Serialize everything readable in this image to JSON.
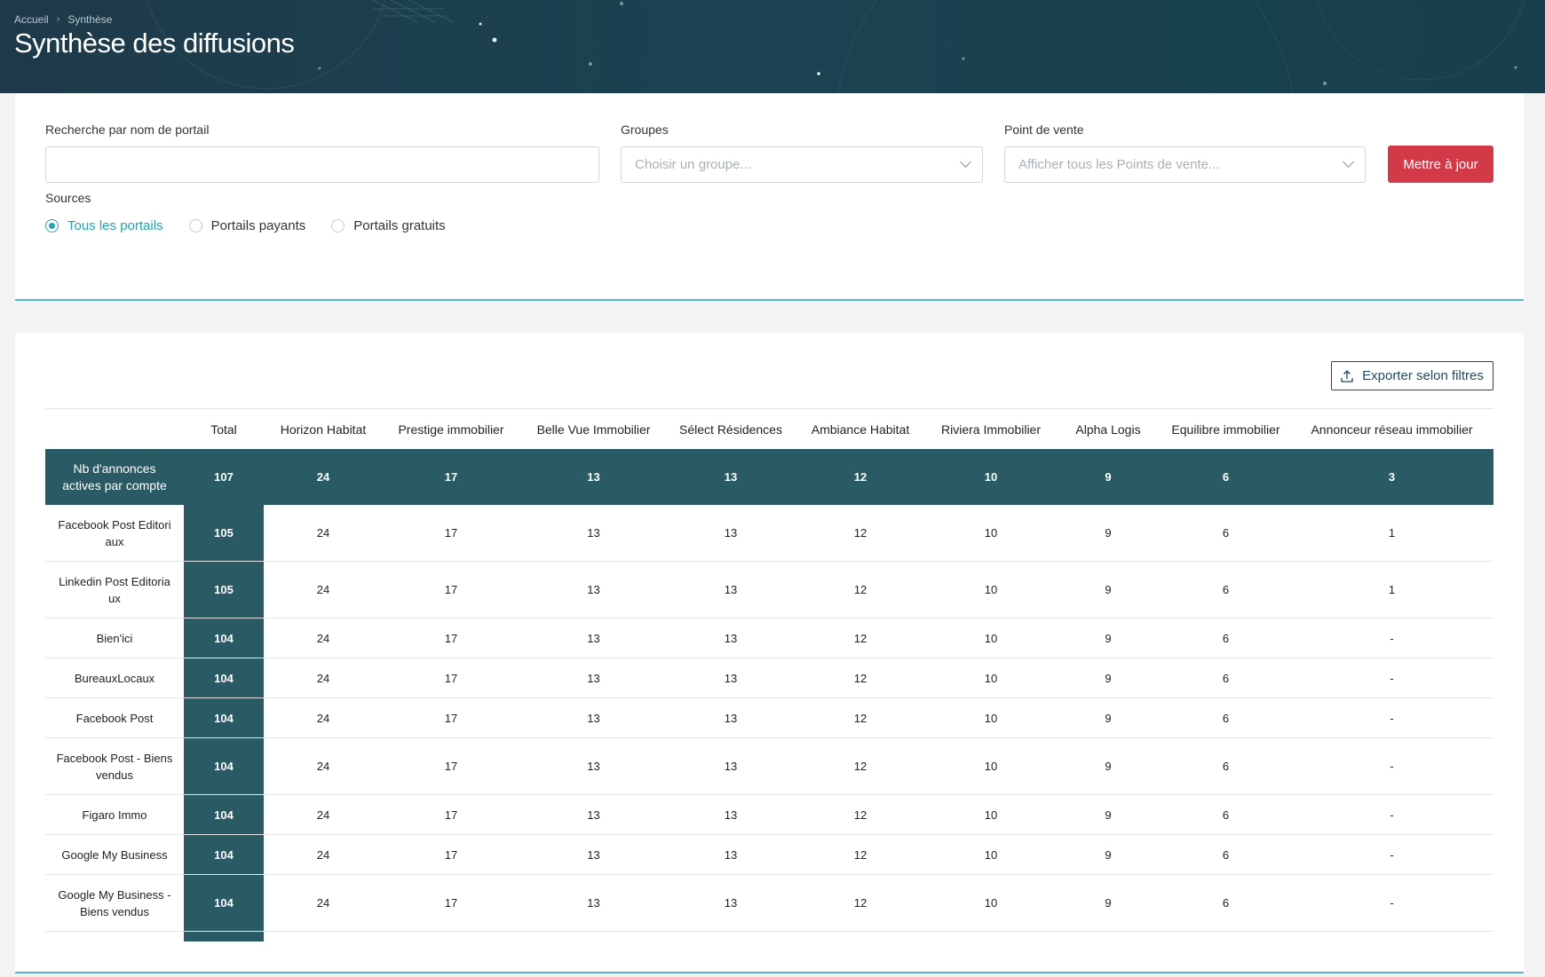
{
  "breadcrumb": {
    "home": "Accueil",
    "current": "Synthèse"
  },
  "page_title": "Synthèse des diffusions",
  "filters": {
    "search_label": "Recherche par nom de portail",
    "search_value": "",
    "groups_label": "Groupes",
    "groups_placeholder": "Choisir un groupe...",
    "pos_label": "Point de vente",
    "pos_placeholder": "Afficher tous les Points de vente...",
    "update_button": "Mettre à jour",
    "sources_label": "Sources",
    "sources": [
      {
        "label": "Tous les portails",
        "checked": true
      },
      {
        "label": "Portails payants",
        "checked": false
      },
      {
        "label": "Portails gratuits",
        "checked": false
      }
    ]
  },
  "export_button": "Exporter selon filtres",
  "table": {
    "headers": [
      "",
      "Total",
      "Horizon Habitat",
      "Prestige immobilier",
      "Belle Vue Immobilier",
      "Sélect Résidences",
      "Ambiance Habitat",
      "Riviera Immobilier",
      "Alpha Logis",
      "Equilibre immobilier",
      "Annonceur réseau immobilier"
    ],
    "summary": {
      "label": "Nb d'annonces actives par compte",
      "values": [
        "107",
        "24",
        "17",
        "13",
        "13",
        "12",
        "10",
        "9",
        "6",
        "3"
      ]
    },
    "rows": [
      {
        "label": "Facebook Post Editori aux",
        "values": [
          "105",
          "24",
          "17",
          "13",
          "13",
          "12",
          "10",
          "9",
          "6",
          "1"
        ]
      },
      {
        "label": "Linkedin Post Editoria ux",
        "values": [
          "105",
          "24",
          "17",
          "13",
          "13",
          "12",
          "10",
          "9",
          "6",
          "1"
        ]
      },
      {
        "label": "Bien'ici",
        "values": [
          "104",
          "24",
          "17",
          "13",
          "13",
          "12",
          "10",
          "9",
          "6",
          "-"
        ]
      },
      {
        "label": "BureauxLocaux",
        "values": [
          "104",
          "24",
          "17",
          "13",
          "13",
          "12",
          "10",
          "9",
          "6",
          "-"
        ]
      },
      {
        "label": "Facebook Post",
        "values": [
          "104",
          "24",
          "17",
          "13",
          "13",
          "12",
          "10",
          "9",
          "6",
          "-"
        ]
      },
      {
        "label": "Facebook Post - Biens vendus",
        "values": [
          "104",
          "24",
          "17",
          "13",
          "13",
          "12",
          "10",
          "9",
          "6",
          "-"
        ]
      },
      {
        "label": "Figaro Immo",
        "values": [
          "104",
          "24",
          "17",
          "13",
          "13",
          "12",
          "10",
          "9",
          "6",
          "-"
        ]
      },
      {
        "label": "Google My Business",
        "values": [
          "104",
          "24",
          "17",
          "13",
          "13",
          "12",
          "10",
          "9",
          "6",
          "-"
        ]
      },
      {
        "label": "Google My Business - Biens vendus",
        "values": [
          "104",
          "24",
          "17",
          "13",
          "13",
          "12",
          "10",
          "9",
          "6",
          "-"
        ]
      }
    ]
  },
  "colors": {
    "header_bg": "#1e3a4a",
    "primary_button": "#d33a47",
    "accent": "#27a2ad",
    "table_dark": "#2a5a64",
    "divider": "#56b5c8"
  }
}
